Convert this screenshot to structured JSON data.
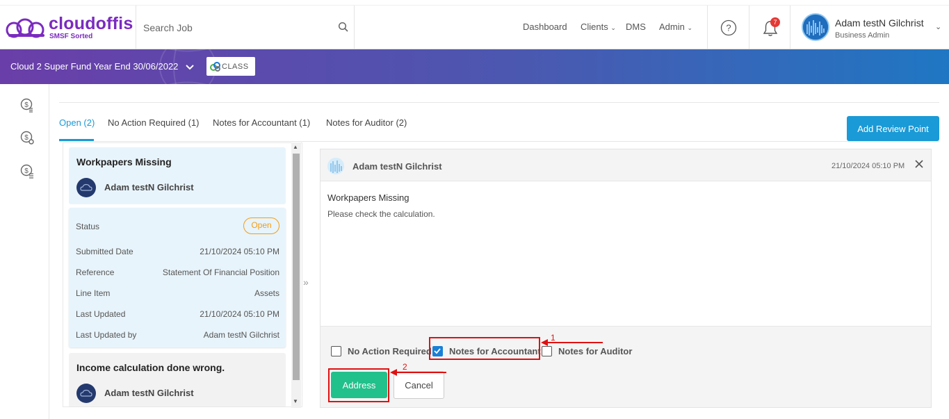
{
  "brand": {
    "name": "cloudoffis",
    "tagline": "SMSF Sorted",
    "color": "#7b2bbf"
  },
  "search": {
    "placeholder": "Search Job",
    "icon": "search-icon"
  },
  "nav": {
    "dashboard": "Dashboard",
    "clients": "Clients",
    "dms": "DMS",
    "admin": "Admin"
  },
  "notifications": {
    "count": "7",
    "icon": "bell-icon"
  },
  "help": {
    "icon": "help-icon"
  },
  "user": {
    "name": "Adam testN Gilchrist",
    "role": "Business Admin"
  },
  "banner": {
    "title": "Cloud 2 Super Fund Year End 30/06/2022",
    "partner_logo_text": "CLASS"
  },
  "sidebar": {
    "icons": [
      "dollar-refresh-icon",
      "dollar-gear-icon",
      "dollar-list-icon"
    ]
  },
  "tabs": [
    {
      "label": "Open (2)",
      "active": true
    },
    {
      "label": "No Action Required (1)",
      "active": false
    },
    {
      "label": "Notes for Accountant (1)",
      "active": false
    },
    {
      "label": "Notes for Auditor (2)",
      "active": false
    }
  ],
  "add_review_point": "Add Review Point",
  "review_points": [
    {
      "title": "Workpapers Missing",
      "author": "Adam testN Gilchrist",
      "details": {
        "status_label": "Status",
        "status": "Open",
        "submitted_label": "Submitted Date",
        "submitted": "21/10/2024 05:10 PM",
        "reference_label": "Reference",
        "reference": "Statement Of Financial Position",
        "line_item_label": "Line Item",
        "line_item": "Assets",
        "last_updated_label": "Last Updated",
        "last_updated": "21/10/2024 05:10 PM",
        "last_updated_by_label": "Last Updated by",
        "last_updated_by": "Adam testN Gilchrist"
      }
    },
    {
      "title": "Income calculation done wrong.",
      "author": "Adam testN Gilchrist"
    }
  ],
  "detail": {
    "author": "Adam testN Gilchrist",
    "date": "21/10/2024 05:10 PM",
    "subject": "Workpapers Missing",
    "body": "Please check the calculation.",
    "options": [
      {
        "label": "No Action Required",
        "checked": false
      },
      {
        "label": "Notes for Accountant",
        "checked": true
      },
      {
        "label": "Notes for Auditor",
        "checked": false
      }
    ],
    "address_button": "Address",
    "cancel_button": "Cancel"
  },
  "annotations": {
    "step1": "1",
    "step2": "2",
    "color": "#e01010"
  },
  "colors": {
    "accent": "#1a9ad6",
    "success": "#22c08a",
    "status_open": "#f39c12",
    "badge": "#e53935"
  }
}
